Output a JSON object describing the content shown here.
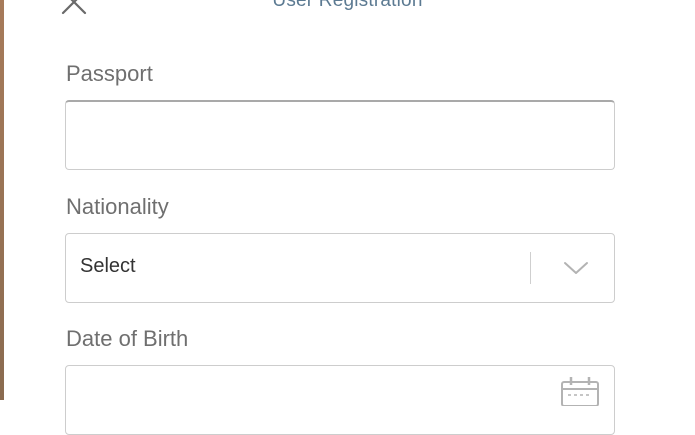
{
  "header": {
    "title": "User Registration",
    "close_icon": "close-icon"
  },
  "form": {
    "passport": {
      "label": "Passport",
      "value": "",
      "placeholder": ""
    },
    "nationality": {
      "label": "Nationality",
      "selected": "Select",
      "dropdown_icon": "chevron-down-icon"
    },
    "dob": {
      "label": "Date of Birth",
      "value": "",
      "placeholder": "",
      "icon": "calendar-icon"
    }
  },
  "colors": {
    "title": "#5c7a92",
    "label": "#6f6f6f",
    "border": "#cdcdcd",
    "icon": "#b3b3b3"
  }
}
